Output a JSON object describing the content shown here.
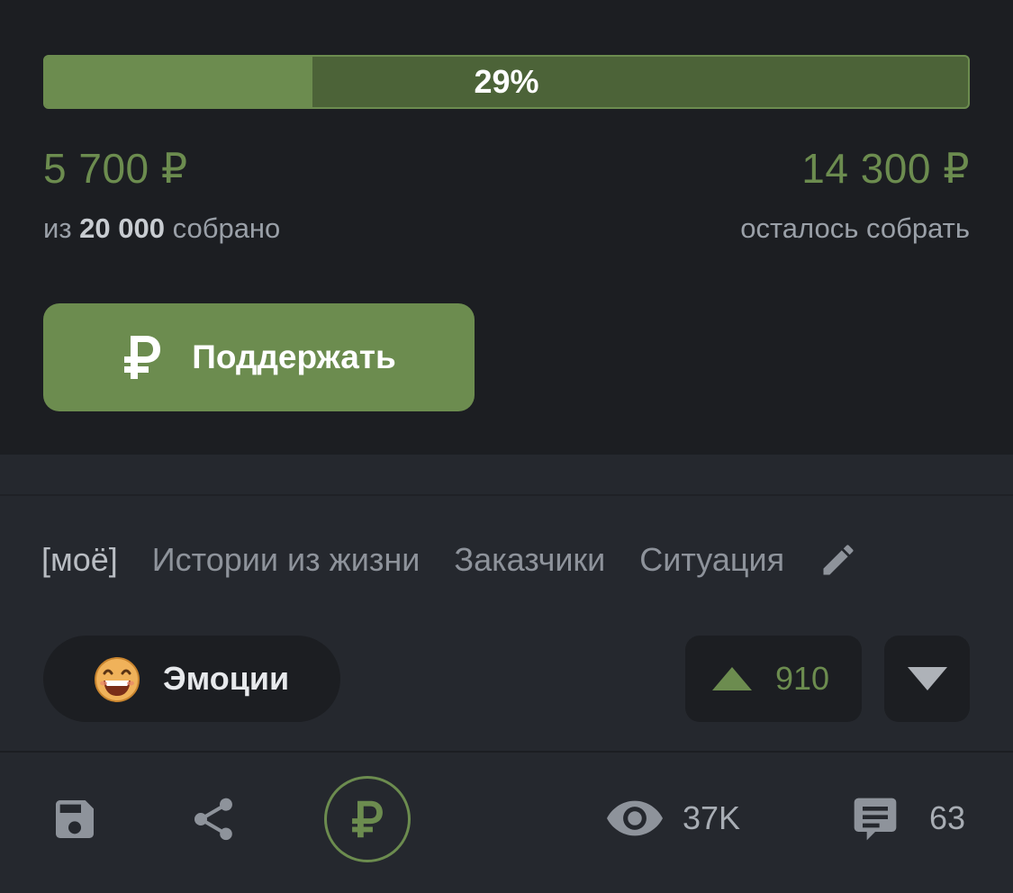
{
  "colors": {
    "accent": "#6c8c4f",
    "accent_dark": "#4c6338",
    "panel_bg": "#1c1e22",
    "page_bg": "#25282e",
    "text_muted": "#8e939b"
  },
  "donation": {
    "progress": {
      "percent": 29,
      "label": "29%"
    },
    "collected_amount": "5 700 ₽",
    "collected_prefix": "из",
    "goal": "20 000",
    "collected_suffix": "собрано",
    "remaining_amount": "14 300 ₽",
    "remaining_label": "осталось собрать",
    "support_button": {
      "label": "Поддержать",
      "icon": "ruble-icon"
    }
  },
  "tags": [
    "[моё]",
    "Истории из жизни",
    "Заказчики",
    "Ситуация"
  ],
  "tags_edit_icon": "pencil-icon",
  "emotion": {
    "emoji": "grinning-face-icon",
    "label": "Эмоции"
  },
  "rating": {
    "up_icon": "triangle-up-icon",
    "count": "910",
    "down_icon": "triangle-down-icon"
  },
  "actions": {
    "save_icon": "floppy-disk-icon",
    "share_icon": "share-icon",
    "donate_icon": "ruble-icon",
    "views_icon": "eye-icon",
    "views": "37K",
    "comments_icon": "comment-icon",
    "comments": "63"
  }
}
